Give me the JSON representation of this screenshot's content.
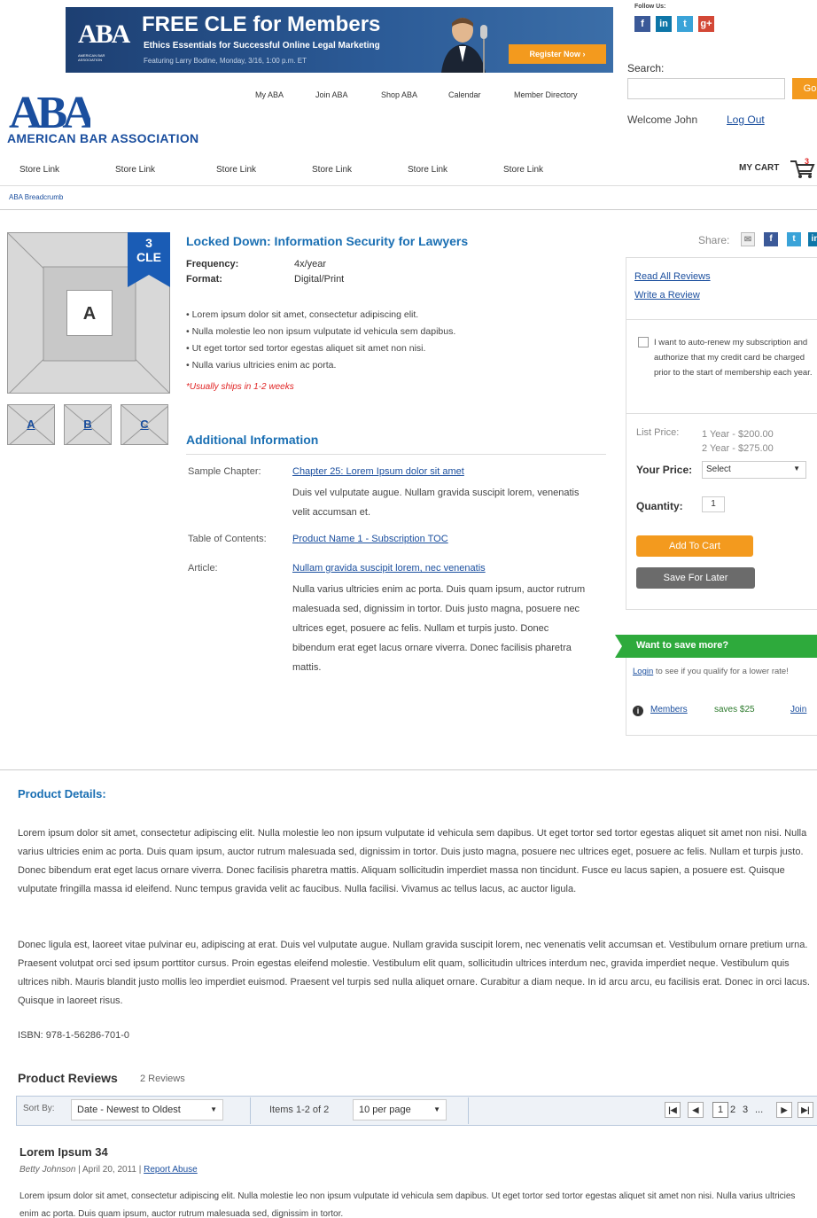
{
  "banner": {
    "logo": "ABA",
    "logo_sub": "AMERICAN BAR ASSOCIATION",
    "title": "FREE CLE for Members",
    "subtitle": "Ethics Essentials for Successful Online Legal Marketing",
    "detail": "Featuring Larry Bodine, Monday, 3/16, 1:00 p.m. ET",
    "button": "Register Now ›"
  },
  "social": {
    "follow_label": "Follow Us:",
    "icons": [
      "facebook-icon",
      "linkedin-icon",
      "twitter-icon",
      "googleplus-icon"
    ]
  },
  "search": {
    "label": "Search:",
    "placeholder": "",
    "go": "Go"
  },
  "user": {
    "welcome": "Welcome John",
    "logout": "Log Out"
  },
  "logo": {
    "mark": "ABA",
    "name": "AMERICAN BAR ASSOCIATION"
  },
  "topnav": [
    "My ABA",
    "Join ABA",
    "Shop ABA",
    "Calendar",
    "Member Directory"
  ],
  "storenav": [
    "Store Link",
    "Store Link",
    "Store Link",
    "Store Link",
    "Store Link",
    "Store Link"
  ],
  "cart": {
    "label": "MY CART",
    "count": "3"
  },
  "breadcrumb": "ABA Breadcrumb",
  "product": {
    "image_label": "A",
    "cle_num": "3",
    "cle_label": "CLE",
    "thumbs": [
      "A",
      "B",
      "C"
    ],
    "title": "Locked Down: Information Security for Lawyers",
    "frequency_label": "Frequency:",
    "frequency": "4x/year",
    "format_label": "Format:",
    "format": "Digital/Print",
    "bullets": [
      "• Lorem ipsum dolor sit amet, consectetur adipiscing elit.",
      "• Nulla molestie leo non ipsum vulputate id vehicula sem dapibus.",
      "• Ut eget tortor sed tortor egestas aliquet sit amet non nisi.",
      "• Nulla varius ultricies enim ac porta."
    ],
    "ships": "*Usually ships in 1-2 weeks"
  },
  "additional": {
    "title": "Additional Information",
    "sample_label": "Sample Chapter:",
    "sample_link": "Chapter 25: Lorem Ipsum dolor sit amet",
    "sample_desc": "Duis vel vulputate augue. Nullam gravida suscipit lorem, venenatis velit accumsan et.",
    "toc_label": "Table of Contents:",
    "toc_link": "Product Name 1 - Subscription TOC",
    "article_label": "Article:",
    "article_link": "Nullam gravida suscipit lorem, nec venenatis",
    "article_desc": "Nulla varius ultricies enim ac porta. Duis quam ipsum, auctor rutrum malesuada sed, dignissim in tortor. Duis justo magna, posuere nec ultrices eget, posuere ac felis. Nullam et turpis justo. Donec bibendum erat eget lacus ornare viverra. Donec facilisis pharetra mattis."
  },
  "share": {
    "label": "Share:"
  },
  "purchase": {
    "read_reviews": "Read All Reviews",
    "write_review": "Write a Review",
    "autorenew": "I want to auto-renew my subscription and authorize that my credit card be charged prior to the start of membership each year.",
    "list_price_label": "List Price:",
    "list_price_1": "1 Year - $200.00",
    "list_price_2": "2 Year - $275.00",
    "your_price_label": "Your Price:",
    "your_price_value": "Select",
    "quantity_label": "Quantity:",
    "quantity_value": "1",
    "add_to_cart": "Add To Cart",
    "save_later": "Save For Later"
  },
  "savemore": {
    "title": "Want to save more?",
    "login": "Login",
    "login_text": " to see if you qualify for a lower rate!",
    "members": "Members",
    "saves": "saves $25",
    "join": "Join"
  },
  "details": {
    "title": "Product Details:",
    "para1": "Lorem ipsum dolor sit amet, consectetur adipiscing elit. Nulla molestie leo non ipsum vulputate id vehicula sem dapibus. Ut eget tortor sed tortor egestas aliquet sit amet non nisi. Nulla varius ultricies enim ac porta. Duis quam ipsum, auctor rutrum malesuada sed, dignissim in tortor. Duis justo magna, posuere nec ultrices eget, posuere ac felis. Nullam et turpis justo. Donec bibendum erat eget lacus ornare viverra. Donec facilisis pharetra mattis. Aliquam sollicitudin imperdiet massa non tincidunt. Fusce eu lacus sapien, a posuere est. Quisque vulputate fringilla massa id eleifend. Nunc tempus gravida velit ac faucibus. Nulla facilisi. Vivamus ac tellus lacus, ac auctor ligula.",
    "para2": "Donec ligula est, laoreet vitae pulvinar eu, adipiscing at erat. Duis vel vulputate augue. Nullam gravida suscipit lorem, nec venenatis velit accumsan et. Vestibulum ornare pretium urna. Praesent volutpat orci sed ipsum porttitor cursus. Proin egestas eleifend molestie. Vestibulum elit quam, sollicitudin ultrices interdum nec, gravida imperdiet neque. Vestibulum quis ultrices nibh. Mauris blandit justo mollis leo imperdiet euismod. Praesent vel turpis sed nulla aliquet ornare. Curabitur a diam neque. In id arcu arcu, eu facilisis erat. Donec in orci lacus. Quisque in laoreet risus.",
    "isbn": "ISBN: 978-1-56286-701-0"
  },
  "reviews": {
    "title": "Product Reviews",
    "count": "2 Reviews",
    "sort_label": "Sort By:",
    "sort_value": "Date - Newest to Oldest",
    "items": "Items 1-2 of 2",
    "per_page": "10 per page",
    "pages": [
      "1",
      "2",
      "3",
      "..."
    ],
    "first": {
      "title": "Lorem Ipsum 34",
      "author": "Betty Johnson",
      "date": "April 20, 2011",
      "report": "Report Abuse",
      "body": "Lorem ipsum dolor sit amet, consectetur adipiscing elit. Nulla molestie leo non ipsum vulputate id vehicula sem dapibus. Ut eget tortor sed tortor egestas aliquet sit amet non nisi. Nulla varius ultricies enim ac porta. Duis quam ipsum, auctor rutrum malesuada sed, dignissim in tortor."
    }
  },
  "colors": {
    "brand_blue": "#1a4e9e",
    "accent_orange": "#f39a1e",
    "save_green": "#2eaa3c"
  }
}
